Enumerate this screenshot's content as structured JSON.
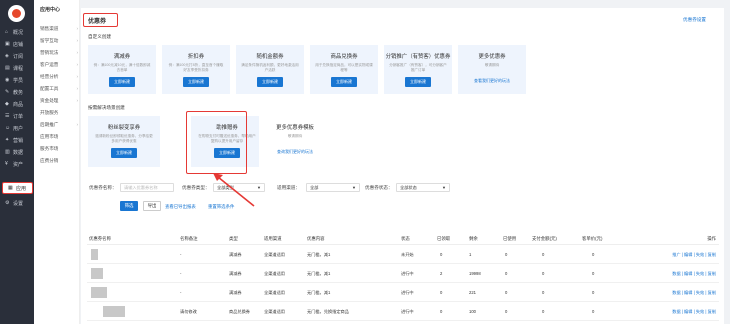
{
  "leftnav": [
    {
      "label": "概况",
      "icon": "home-icon"
    },
    {
      "label": "店铺",
      "icon": "store-icon"
    },
    {
      "label": "订阅",
      "icon": "subscribe-icon"
    },
    {
      "label": "课程",
      "icon": "course-icon"
    },
    {
      "label": "学员",
      "icon": "user-icon"
    },
    {
      "label": "教务",
      "icon": "education-icon"
    },
    {
      "label": "商品",
      "icon": "goods-icon"
    },
    {
      "label": "订单",
      "icon": "order-icon"
    },
    {
      "label": "用户",
      "icon": "users-icon"
    },
    {
      "label": "营销",
      "icon": "marketing-icon"
    },
    {
      "label": "数据",
      "icon": "data-icon"
    },
    {
      "label": "资产",
      "icon": "asset-icon"
    },
    {
      "label": "应用",
      "icon": "app-icon"
    },
    {
      "label": "设置",
      "icon": "settings-icon"
    }
  ],
  "subnav": {
    "title": "应用中心",
    "items": [
      "销售渠道",
      "留学互动",
      "营销玩法",
      "客户运营",
      "经营分析",
      "配置工具",
      "资金处理",
      "开放服务",
      "后期推广",
      "应用市场",
      "服务市场",
      "应费分销"
    ]
  },
  "page": {
    "title": "优惠券",
    "settings_link": "优惠券设置"
  },
  "sections": {
    "custom": "自定义创建",
    "scenario": "按需解决场景创建"
  },
  "custom_cards": [
    {
      "title": "满减券",
      "desc": "例：满100元减10元，满十倍数即减去首单",
      "btn": "立即新建"
    },
    {
      "title": "折扣券",
      "desc": "例：满100元打8折，直至首个赚取好友享受折扣券",
      "btn": "立即新建"
    },
    {
      "title": "随机金额券",
      "desc": "满足条件随机返利额，更好地激活用户活跃",
      "btn": "立即新建"
    },
    {
      "title": "商品兑换券",
      "desc": "用于兑换指定商品，可以是实物或课程等",
      "btn": "立即新建"
    },
    {
      "title": "分销推广（有赞客）优惠券",
      "desc": "分销客推广（有赞客），可分销客户推广订单",
      "btn": "立即新建"
    },
    {
      "title": "更多优惠券",
      "desc": "敬请期待",
      "link": "查看我们更好的玩法"
    }
  ],
  "scenario_cards": [
    {
      "title": "粉丝裂变享券",
      "desc": "邀请新粉丝即领取优惠券，分享给更多用户获得优惠",
      "btn": "立即新建"
    },
    {
      "title": "助推赠券",
      "desc": "在购物支付时赠送优惠券，帮助用户复购以提升用户留存",
      "btn": "立即新建"
    },
    {
      "title": "更多优惠券模板",
      "desc": "敬请期待",
      "link": "查询我们更好的玩法"
    }
  ],
  "filters": {
    "name_label": "优惠券名称：",
    "name_placeholder": "请输入优惠券名称",
    "type_label": "优惠券类型：",
    "type_value": "全部类型",
    "channel_label": "适用渠道：",
    "channel_value": "全部",
    "status_label": "优惠券状态：",
    "status_value": "全部状态",
    "search_btn": "筛选",
    "export_btn": "导出",
    "export_link": "查看已导出报表",
    "reset_link": "重置筛选条件"
  },
  "table": {
    "headers": [
      "优惠券名称",
      "名称备注",
      "类型",
      "适用渠道",
      "优惠内容",
      "状态",
      "已领取",
      "剩余",
      "已使用",
      "支付金额(元)",
      "客单价(元)",
      "操作"
    ],
    "rows": [
      {
        "remark": "-",
        "type": "满减券",
        "channel": "全渠道适用",
        "content": "无门槛，减1",
        "status": "未开始",
        "claimed": "0",
        "remain": "1",
        "used": "0",
        "pay": "0",
        "avg": "0",
        "ops": "推广 | 编辑 | 失效 | 复制"
      },
      {
        "remark": "-",
        "type": "满减券",
        "channel": "全渠道适用",
        "content": "无门槛，减1",
        "status": "进行中",
        "claimed": "2",
        "remain": "19998",
        "used": "0",
        "pay": "0",
        "avg": "0",
        "ops": "数据 | 编辑 | 失效 | 复制"
      },
      {
        "remark": "-",
        "type": "满减券",
        "channel": "全渠道适用",
        "content": "无门槛，减1",
        "status": "进行中",
        "claimed": "0",
        "remain": "221",
        "used": "0",
        "pay": "0",
        "avg": "0",
        "ops": "数据 | 编辑 | 失效 | 复制"
      },
      {
        "remark": "请勿修改",
        "type": "商品兑换券",
        "channel": "全渠道适用",
        "content": "无门槛，兑换指定商品",
        "status": "进行中",
        "claimed": "0",
        "remain": "100",
        "used": "0",
        "pay": "0",
        "avg": "0",
        "ops": "数据 | 编辑 | 失效 | 复制"
      }
    ]
  },
  "colors": {
    "accent": "#1976d2",
    "highlight": "#e53935",
    "nav_bg": "#2a2f3a",
    "card_bg": "#eef4fd"
  }
}
